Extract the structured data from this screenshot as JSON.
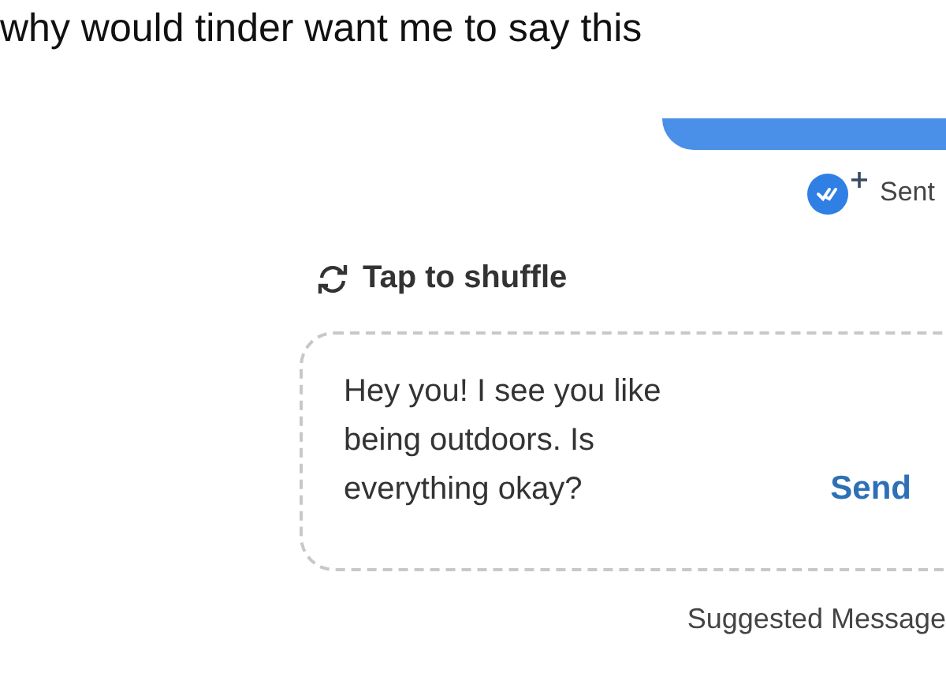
{
  "caption": "why would tinder want me to say this",
  "sent_message": {
    "status": "Sent",
    "read": true
  },
  "shuffle": {
    "label": "Tap to shuffle"
  },
  "suggestion": {
    "text": "Hey you! I see you like being outdoors. Is everything okay?",
    "action": "Send",
    "footer": "Suggested Message"
  }
}
